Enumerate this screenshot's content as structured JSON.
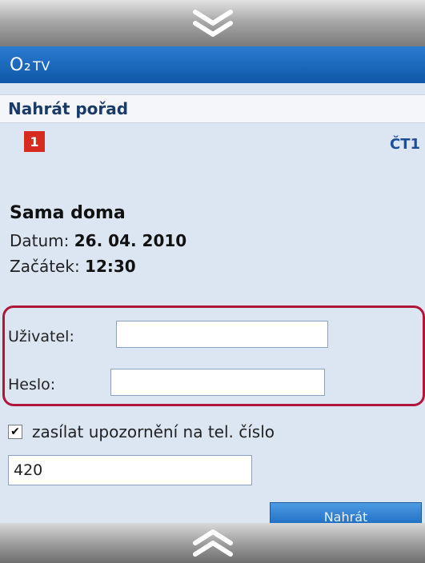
{
  "nav": {
    "top_icon": "chevron-double-down-icon",
    "bottom_icon": "chevron-double-up-icon"
  },
  "header": {
    "brand": "O₂",
    "brand_suffix": "TV"
  },
  "page": {
    "title": "Nahrát pořad"
  },
  "channel": {
    "logo_text": "1",
    "name": "ČT1"
  },
  "program": {
    "name": "Sama doma",
    "date_label": "Datum:",
    "date_value": "26. 04. 2010",
    "start_label": "Začátek:",
    "start_value": "12:30"
  },
  "login": {
    "user_label": "Uživatel:",
    "user_value": "",
    "password_label": "Heslo:",
    "password_value": ""
  },
  "notify": {
    "checked": true,
    "check_mark": "✔",
    "label": "zasílat upozornění na tel. číslo"
  },
  "phone": {
    "value": "420"
  },
  "submit": {
    "label": "Nahrát"
  },
  "colors": {
    "brand_blue": "#0f57a8",
    "highlight_border": "#b0163a",
    "background": "#dbe6f2"
  }
}
